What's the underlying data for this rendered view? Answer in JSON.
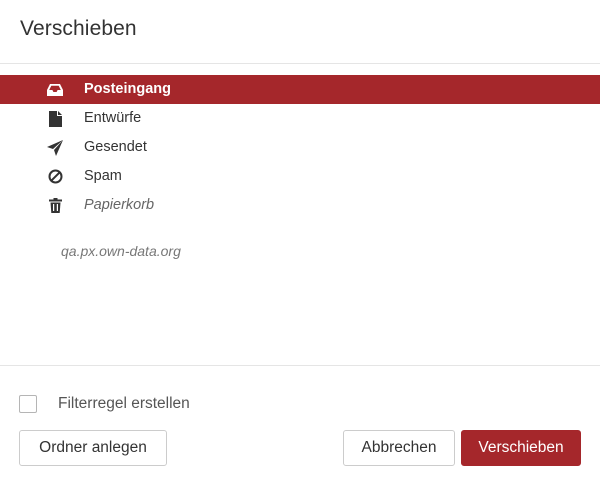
{
  "dialog": {
    "title": "Verschieben"
  },
  "folders": [
    {
      "label": "Posteingang",
      "icon": "inbox-icon",
      "selected": true
    },
    {
      "label": "Entwürfe",
      "icon": "file-icon",
      "selected": false
    },
    {
      "label": "Gesendet",
      "icon": "paper-plane-icon",
      "selected": false
    },
    {
      "label": "Spam",
      "icon": "ban-icon",
      "selected": false
    },
    {
      "label": "Papierkorb",
      "icon": "trash-icon",
      "selected": false
    }
  ],
  "account": {
    "label": "qa.px.own-data.org"
  },
  "footer": {
    "filter_checkbox_label": "Filterregel erstellen",
    "filter_checked": false,
    "create_folder_label": "Ordner anlegen",
    "cancel_label": "Abbrechen",
    "move_label": "Verschieben"
  },
  "colors": {
    "accent": "#a5272b",
    "selected_text": "#ffffff",
    "text": "#333333",
    "muted": "#777777",
    "border": "#e5e5e5"
  }
}
